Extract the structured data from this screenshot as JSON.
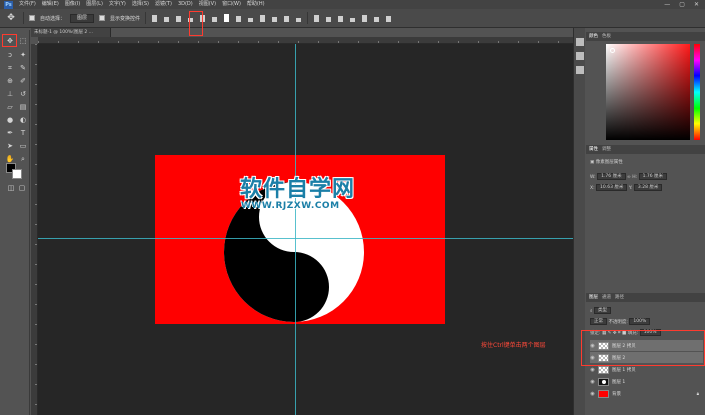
{
  "menubar": {
    "logo": "Ps",
    "items": [
      "文件(F)",
      "编辑(E)",
      "图像(I)",
      "图层(L)",
      "文字(Y)",
      "选择(S)",
      "滤镜(T)",
      "3D(D)",
      "视图(V)",
      "窗口(W)",
      "帮助(H)"
    ],
    "win_controls": [
      "—",
      "▢",
      "✕"
    ]
  },
  "options": {
    "auto_select_label": "自动选择：",
    "auto_select_value": "图层",
    "transform_label": "显示变换控件"
  },
  "document": {
    "tab_title": "未标题-1 @ 100%(图层 2 ...",
    "watermark_cn": "软件自学网",
    "watermark_url": "WWW.RJZXW.COM"
  },
  "panels": {
    "color_tabs": [
      "颜色",
      "色板"
    ],
    "props_tabs": [
      "属性",
      "调整"
    ],
    "props_kind": "像素图层属性",
    "w_label": "W:",
    "w_value": "1.76 厘米",
    "h_label": "H:",
    "h_value": "1.76 厘米",
    "x_label": "X:",
    "x_value": "10.63 厘米",
    "y_label": "Y:",
    "y_value": "3.28 厘米",
    "layers_tabs": [
      "图层",
      "通道",
      "路径"
    ],
    "kind_label": "类型",
    "blend_mode": "正常",
    "opacity_label": "不透明度:",
    "opacity_value": "100%",
    "lock_label": "锁定:",
    "fill_label": "填充:",
    "fill_value": "100%",
    "layers": [
      {
        "name": "图层 2 拷贝",
        "selected": true
      },
      {
        "name": "图层 2",
        "selected": true
      },
      {
        "name": "图层 1 拷贝",
        "selected": false
      },
      {
        "name": "图层 1",
        "selected": false
      },
      {
        "name": "背景",
        "selected": false
      }
    ]
  },
  "annotation": "按住Ctrl键单击两个图层",
  "colors": {
    "highlight": "#ff3b2f",
    "document_bg": "#ff0000",
    "guide": "#3bb6c6",
    "watermark": "#1b7fa7"
  }
}
